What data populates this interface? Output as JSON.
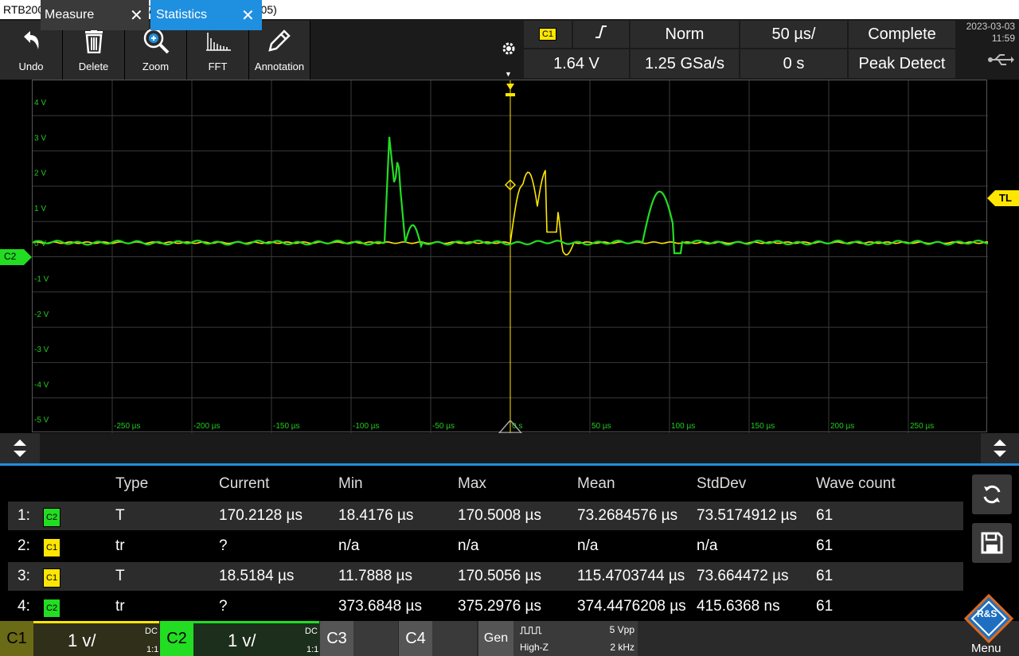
{
  "title_bar": "RTB2004; 1333.1005K04; 107509 (02.300 2020-10-05)",
  "toolbar": {
    "buttons": [
      {
        "label": "Undo",
        "icon": "undo-icon"
      },
      {
        "label": "Delete",
        "icon": "trash-icon"
      },
      {
        "label": "Zoom",
        "icon": "zoom-icon"
      },
      {
        "label": "FFT",
        "icon": "fft-icon"
      },
      {
        "label": "Annotation",
        "icon": "pencil-icon"
      }
    ],
    "settings_icon": "gear-icon"
  },
  "trigger": {
    "source": "C1",
    "slope_icon": "rising-edge-icon",
    "mode": "Norm",
    "timebase": "50 µs/",
    "acq_state": "Complete",
    "level": "1.64 V",
    "sample_rate": "1.25 GSa/s",
    "position": "0 s",
    "acq_mode": "Peak Detect"
  },
  "datetime": {
    "date": "2023-03-03",
    "time": "11:59"
  },
  "usb_icon": "usb-icon",
  "plot": {
    "y_labels": [
      "4 V",
      "3 V",
      "2 V",
      "1 V",
      "0 V",
      "-1 V",
      "-2 V",
      "-3 V",
      "-4 V",
      "-5 V"
    ],
    "x_labels": [
      "-250 µs",
      "-200 µs",
      "-150 µs",
      "-100 µs",
      "-50 µs",
      "0 s",
      "50 µs",
      "100 µs",
      "150 µs",
      "200 µs",
      "250 µs"
    ],
    "c2_marker": "C2",
    "tl_marker": "TL",
    "colors": {
      "c1": "#ffe600",
      "c2": "#22dd22",
      "grid": "#3a3a3a",
      "axis_text": "#22cc22"
    }
  },
  "tabs": [
    {
      "label": "Measure",
      "active": false
    },
    {
      "label": "Statistics",
      "active": true
    }
  ],
  "stats": {
    "headers": [
      "Type",
      "Current",
      "Min",
      "Max",
      "Mean",
      "StdDev",
      "Wave count"
    ],
    "rows": [
      {
        "idx": "1:",
        "ch": "C2",
        "type": "T",
        "current": "170.2128 µs",
        "min": "18.4176 µs",
        "max": "170.5008 µs",
        "mean": "73.2684576 µs",
        "std": "73.5174912 µs",
        "count": "61"
      },
      {
        "idx": "2:",
        "ch": "C1",
        "type": "tr",
        "current": "?",
        "min": "n/a",
        "max": "n/a",
        "mean": "n/a",
        "std": "n/a",
        "count": "61"
      },
      {
        "idx": "3:",
        "ch": "C1",
        "type": "T",
        "current": "18.5184 µs",
        "min": "11.7888 µs",
        "max": "170.5056 µs",
        "mean": "115.4703744 µs",
        "std": "73.664472 µs",
        "count": "61"
      },
      {
        "idx": "4:",
        "ch": "C2",
        "type": "tr",
        "current": "?",
        "min": "373.6848 µs",
        "max": "375.2976 µs",
        "mean": "374.4476208 µs",
        "std": "415.6368 ns",
        "count": "61"
      }
    ]
  },
  "side_buttons": [
    {
      "icon": "refresh-icon"
    },
    {
      "icon": "save-icon"
    }
  ],
  "bottom": {
    "c1": {
      "label": "C1",
      "scale": "1 v/",
      "coupling": "DC",
      "ratio": "1:1"
    },
    "c2": {
      "label": "C2",
      "scale": "1 v/",
      "coupling": "DC",
      "ratio": "1:1"
    },
    "c3": {
      "label": "C3"
    },
    "c4": {
      "label": "C4"
    },
    "gen": {
      "label": "Gen",
      "wave": "⎍⎍⎍",
      "impedance": "High-Z",
      "amplitude": "5 Vpp",
      "frequency": "2 kHz"
    },
    "menu": "Menu",
    "logo": "R&S"
  }
}
